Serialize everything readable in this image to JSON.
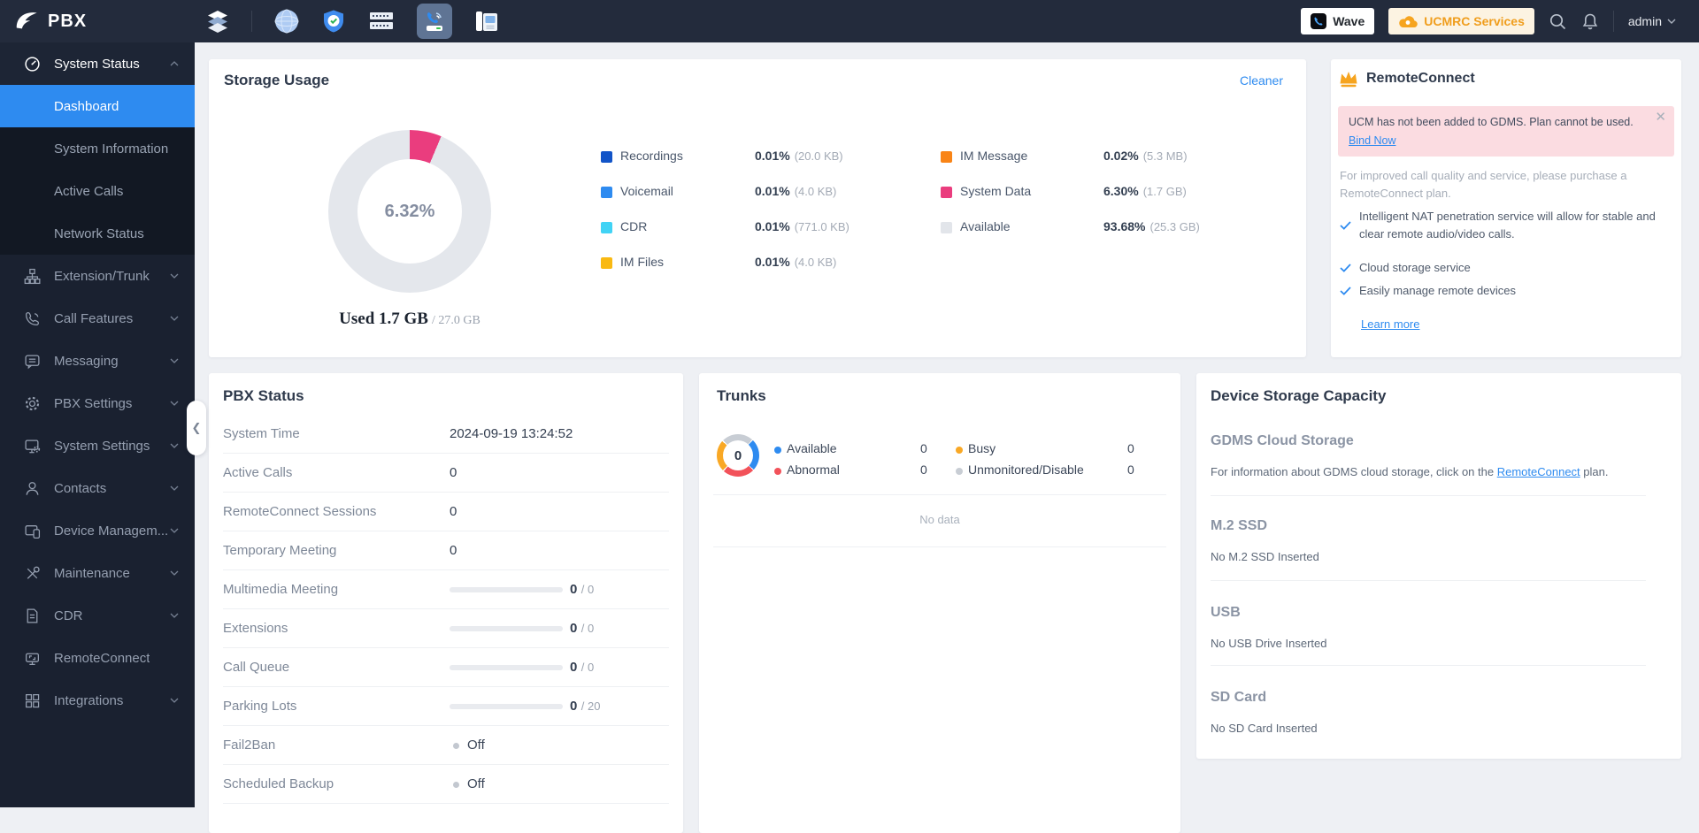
{
  "topbar": {
    "brand": "PBX",
    "wave_button": "Wave",
    "ucmrc_button": "UCMRC Services",
    "username": "admin"
  },
  "sidebar": {
    "system_status": {
      "label": "System Status"
    },
    "submenu": [
      {
        "label": "Dashboard"
      },
      {
        "label": "System Information"
      },
      {
        "label": "Active Calls"
      },
      {
        "label": "Network Status"
      }
    ],
    "items": [
      {
        "label": "Extension/Trunk"
      },
      {
        "label": "Call Features"
      },
      {
        "label": "Messaging"
      },
      {
        "label": "PBX Settings"
      },
      {
        "label": "System Settings"
      },
      {
        "label": "Contacts"
      },
      {
        "label": "Device Managem..."
      },
      {
        "label": "Maintenance"
      },
      {
        "label": "CDR"
      },
      {
        "label": "RemoteConnect"
      },
      {
        "label": "Integrations"
      }
    ]
  },
  "storage": {
    "title": "Storage Usage",
    "cleaner_link": "Cleaner",
    "donut": {
      "percent": 6.32,
      "percent_label": "6.32%",
      "used_label": "Used 1.7 GB",
      "total_label": "/ 27.0 GB",
      "slice_color": "#ea3d7e",
      "track_color": "#e4e7ec"
    },
    "legend_col1": [
      {
        "name": "Recordings",
        "percent": "0.01%",
        "size": "(20.0 KB)",
        "color": "#1254c8"
      },
      {
        "name": "Voicemail",
        "percent": "0.01%",
        "size": "(4.0 KB)",
        "color": "#2e8bf0"
      },
      {
        "name": "CDR",
        "percent": "0.01%",
        "size": "(771.0 KB)",
        "color": "#41d3f5"
      },
      {
        "name": "IM Files",
        "percent": "0.01%",
        "size": "(4.0 KB)",
        "color": "#f9b912"
      }
    ],
    "legend_col2": [
      {
        "name": "IM Message",
        "percent": "0.02%",
        "size": "(5.3 MB)",
        "color": "#f98416"
      },
      {
        "name": "System Data",
        "percent": "6.30%",
        "size": "(1.7 GB)",
        "color": "#ea3d7e"
      },
      {
        "name": "Available",
        "percent": "93.68%",
        "size": "(25.3 GB)",
        "color": "#e2e5ea"
      }
    ]
  },
  "remoteconnect": {
    "title": "RemoteConnect",
    "alert_text": "UCM has not been added to GDMS. Plan cannot be used. ",
    "alert_link": "Bind Now",
    "promo": "For improved call quality and service, please purchase a RemoteConnect plan.",
    "features": [
      "Intelligent NAT penetration service will allow for stable and clear remote audio/video calls.",
      "Cloud storage service",
      "Easily manage remote devices"
    ],
    "learn_more": "Learn more"
  },
  "pbx_status": {
    "title": "PBX Status",
    "rows": [
      {
        "label": "System Time",
        "value": "2024-09-19 13:24:52"
      },
      {
        "label": "Active Calls",
        "value": "0"
      },
      {
        "label": "RemoteConnect Sessions",
        "value": "0"
      },
      {
        "label": "Temporary Meeting",
        "value": "0"
      },
      {
        "label": "Multimedia Meeting",
        "used": "0",
        "max": "/ 0"
      },
      {
        "label": "Extensions",
        "used": "0",
        "max": "/ 0"
      },
      {
        "label": "Call Queue",
        "used": "0",
        "max": "/ 0"
      },
      {
        "label": "Parking Lots",
        "used": "0",
        "max": "/ 20"
      },
      {
        "label": "Fail2Ban",
        "status": "Off"
      },
      {
        "label": "Scheduled Backup",
        "status": "Off"
      }
    ]
  },
  "trunks": {
    "title": "Trunks",
    "center_value": "0",
    "legend": [
      {
        "name": "Available",
        "value": "0",
        "color": "#2e8bf0"
      },
      {
        "name": "Abnormal",
        "value": "0",
        "color": "#f2525a"
      },
      {
        "name": "Busy",
        "value": "0",
        "color": "#f9a825"
      },
      {
        "name": "Unmonitored/Disable",
        "value": "0",
        "color": "#c8cdd4"
      }
    ],
    "no_data": "No data"
  },
  "device_storage": {
    "title": "Device Storage Capacity",
    "gdms": {
      "heading": "GDMS Cloud Storage",
      "text_before": "For information about GDMS cloud storage, click on the ",
      "link": "RemoteConnect",
      "text_after": " plan."
    },
    "sections": [
      {
        "heading": "M.2 SSD",
        "status": "No M.2 SSD Inserted"
      },
      {
        "heading": "USB",
        "status": "No USB Drive Inserted"
      },
      {
        "heading": "SD Card",
        "status": "No SD Card Inserted"
      }
    ]
  }
}
